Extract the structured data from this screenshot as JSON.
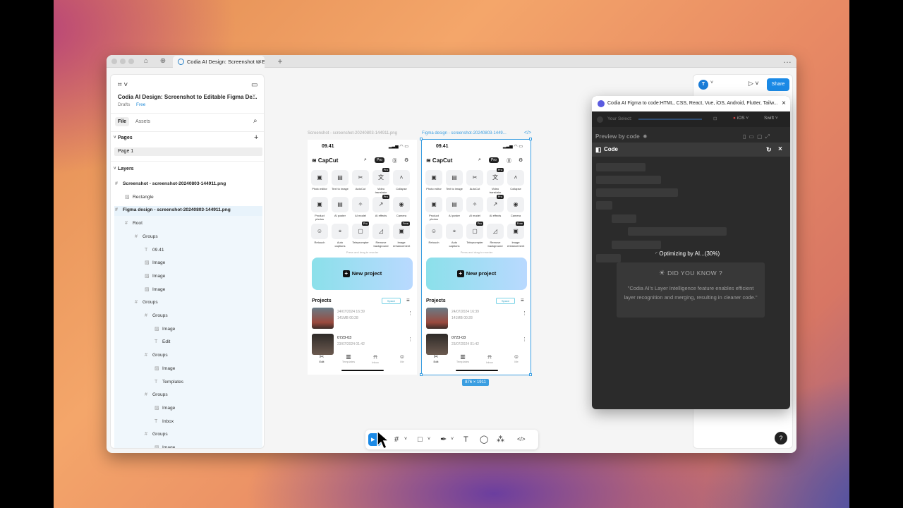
{
  "browser": {
    "tab_title": "Codia AI Design: Screenshot to E",
    "more": "…",
    "new_tab": "+"
  },
  "left": {
    "project_title": "Codia AI Design: Screenshot to Editable Figma De...",
    "drafts": "Drafts",
    "plan": "Free",
    "tab_file": "File",
    "tab_assets": "Assets",
    "pages_label": "Pages",
    "page1": "Page 1",
    "layers_label": "Layers",
    "layers": [
      {
        "text": "Screenshot - screenshot-20240803-144911.png",
        "icon": "#",
        "indent": 0,
        "bold": true
      },
      {
        "text": "Rectangle",
        "icon": "▨",
        "indent": 1,
        "bold": false
      },
      {
        "text": "Figma design - screenshot-20240803-144911.png",
        "icon": "#",
        "indent": 0,
        "bold": true
      },
      {
        "text": "Root",
        "icon": "#",
        "indent": 1,
        "bold": false
      },
      {
        "text": "Groups",
        "icon": "#",
        "indent": 2,
        "bold": false
      },
      {
        "text": "09.41",
        "icon": "T",
        "indent": 3,
        "bold": false
      },
      {
        "text": "Image",
        "icon": "▨",
        "indent": 3,
        "bold": false
      },
      {
        "text": "Image",
        "icon": "▨",
        "indent": 3,
        "bold": false
      },
      {
        "text": "Image",
        "icon": "▨",
        "indent": 3,
        "bold": false
      },
      {
        "text": "Groups",
        "icon": "#",
        "indent": 2,
        "bold": false
      },
      {
        "text": "Groups",
        "icon": "#",
        "indent": 3,
        "bold": false
      },
      {
        "text": "Image",
        "icon": "▨",
        "indent": 4,
        "bold": false
      },
      {
        "text": "Edit",
        "icon": "T",
        "indent": 4,
        "bold": false
      },
      {
        "text": "Groups",
        "icon": "#",
        "indent": 3,
        "bold": false
      },
      {
        "text": "Image",
        "icon": "▨",
        "indent": 4,
        "bold": false
      },
      {
        "text": "Templates",
        "icon": "T",
        "indent": 4,
        "bold": false
      },
      {
        "text": "Groups",
        "icon": "#",
        "indent": 3,
        "bold": false
      },
      {
        "text": "Image",
        "icon": "▨",
        "indent": 4,
        "bold": false
      },
      {
        "text": "Inbox",
        "icon": "T",
        "indent": 4,
        "bold": false
      },
      {
        "text": "Groups",
        "icon": "#",
        "indent": 3,
        "bold": false
      },
      {
        "text": "Image",
        "icon": "▨",
        "indent": 4,
        "bold": false
      }
    ]
  },
  "canvas": {
    "frame1_label": "Screenshot - screenshot-20240803-144911.png",
    "frame2_label": "Figma design - screenshot-20240803-1449...",
    "dimensions": "876 × 1911"
  },
  "phone": {
    "time": "09.41",
    "brand": "CapCut",
    "pro": "Pro",
    "tools": [
      {
        "label": "Photo editor",
        "icon": "▣",
        "pro": ""
      },
      {
        "label": "Text to image",
        "icon": "▤",
        "pro": ""
      },
      {
        "label": "AutoCut",
        "icon": "✂",
        "pro": ""
      },
      {
        "label": "Video translator",
        "icon": "文",
        "pro": "Pro"
      },
      {
        "label": "Collapse",
        "icon": "˄",
        "pro": ""
      },
      {
        "label": "Product photos",
        "icon": "▣",
        "pro": ""
      },
      {
        "label": "AI poster",
        "icon": "▤",
        "pro": ""
      },
      {
        "label": "AI model",
        "icon": "✧",
        "pro": ""
      },
      {
        "label": "AI effects",
        "icon": "↗",
        "pro": "Pro"
      },
      {
        "label": "Camera",
        "icon": "◉",
        "pro": ""
      },
      {
        "label": "Retouch",
        "icon": "☺",
        "pro": ""
      },
      {
        "label": "Auto captions",
        "icon": "⌖",
        "pro": ""
      },
      {
        "label": "Teleprompter",
        "icon": "▢",
        "pro": "Pro"
      },
      {
        "label": "Remove background",
        "icon": "◿",
        "pro": ""
      },
      {
        "label": "Image enhancement",
        "icon": "▣",
        "pro": "Free"
      }
    ],
    "hint": "Press and drag to reorder",
    "new_project": "New project",
    "projects": "Projects",
    "space": "Space",
    "project_items": [
      {
        "title": "24/07/2024 16:39",
        "meta": "141MB   00:28"
      },
      {
        "title": "0723-03",
        "meta": "23/07/2024 01:42"
      }
    ],
    "nav": [
      {
        "label": "Edit",
        "icon": "✂"
      },
      {
        "label": "Templates",
        "icon": "▥"
      },
      {
        "label": "Inbox",
        "icon": "⍾"
      },
      {
        "label": "Me",
        "icon": "☺"
      }
    ]
  },
  "phone2": {
    "time": "09.41",
    "brand": "CapCut",
    "pro": "Pro",
    "hint": "Press and drag to reorder",
    "new_project": "New project",
    "projects": "Projects",
    "space": "Space",
    "project_items": [
      {
        "title": "24/07/2024 16:39",
        "meta": "141MB   00:28"
      },
      {
        "title": "0723-03",
        "meta": "23/07/2024 01:42"
      }
    ]
  },
  "right": {
    "avatar": "T",
    "share": "Share",
    "help": "?"
  },
  "plugin": {
    "title": "Codia AI Figma to code:HTML, CSS, React, Vue, iOS, Android, Flutter, Tailw...",
    "your_select": "Your Select:",
    "platform": "iOS",
    "language": "Swift",
    "preview_by_code": "Preview by code",
    "code_label": "Code",
    "progress_text": "Optimizing by AI...(30%)",
    "progress": 0.3,
    "dyk_title": "DID YOU KNOW ?",
    "dyk_text": "\"Codia AI's Layer Intelligence feature enables efficient layer recognition and merging, resulting in cleaner code.\""
  }
}
